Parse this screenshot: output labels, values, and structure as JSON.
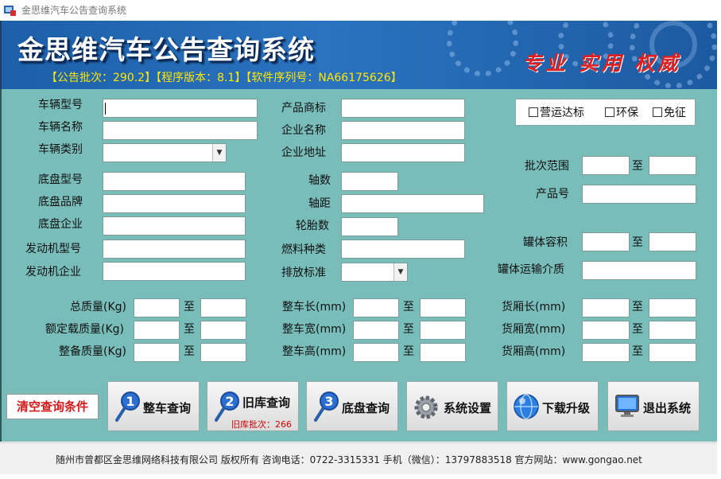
{
  "window": {
    "title": "金思维汽车公告查询系统"
  },
  "header": {
    "app_title": "金思维汽车公告查询系统",
    "info": "【公告批次：290.2】【程序版本：8.1】【软件序列号：NA66175626】",
    "slogan": "专业 实用 权威"
  },
  "form": {
    "vehicle_model": "车辆型号",
    "vehicle_name": "车辆名称",
    "vehicle_category": "车辆类别",
    "chassis_model": "底盘型号",
    "chassis_brand": "底盘品牌",
    "chassis_company": "底盘企业",
    "engine_model": "发动机型号",
    "engine_company": "发动机企业",
    "product_brand": "产品商标",
    "company_name": "企业名称",
    "company_address": "企业地址",
    "axle_count": "轴数",
    "wheelbase": "轴距",
    "tire_count": "轮胎数",
    "fuel_type": "燃料种类",
    "emission_standard": "排放标准",
    "batch_range": "批次范围",
    "product_no": "产品号",
    "tank_volume": "罐体容积",
    "tank_medium": "罐体运输介质",
    "total_mass": "总质量(Kg)",
    "rated_load": "额定载质量(Kg)",
    "curb_mass": "整备质量(Kg)",
    "length": "整车长(mm)",
    "width": "整车宽(mm)",
    "height": "整车高(mm)",
    "cargo_length": "货厢长(mm)",
    "cargo_width": "货厢宽(mm)",
    "cargo_height": "货厢高(mm)",
    "to": "至"
  },
  "checks": {
    "operational": "营运达标",
    "eco": "环保",
    "exempt": "免征"
  },
  "buttons": {
    "clear": "清空查询条件",
    "vehicle_query": "整车查询",
    "old_query": "旧库查询",
    "old_batch": "旧库批次：266",
    "chassis_query": "底盘查询",
    "settings": "系统设置",
    "download": "下载升级",
    "exit": "退出系统"
  },
  "footer": {
    "text": "随州市曾都区金思维网络科技有限公司 版权所有   咨询电话：0722-3315331   手机（微信）：13797883518   官方网站：www.gongao.net"
  },
  "colors": {
    "header_bg": "#2a73c0",
    "form_bg": "#78bdb9",
    "slogan": "#e02020",
    "info": "#ffe800"
  },
  "icons": [
    "app-icon",
    "magnifier-1-icon",
    "magnifier-2-icon",
    "magnifier-3-icon",
    "gear-icon",
    "globe-icon",
    "monitor-icon"
  ]
}
